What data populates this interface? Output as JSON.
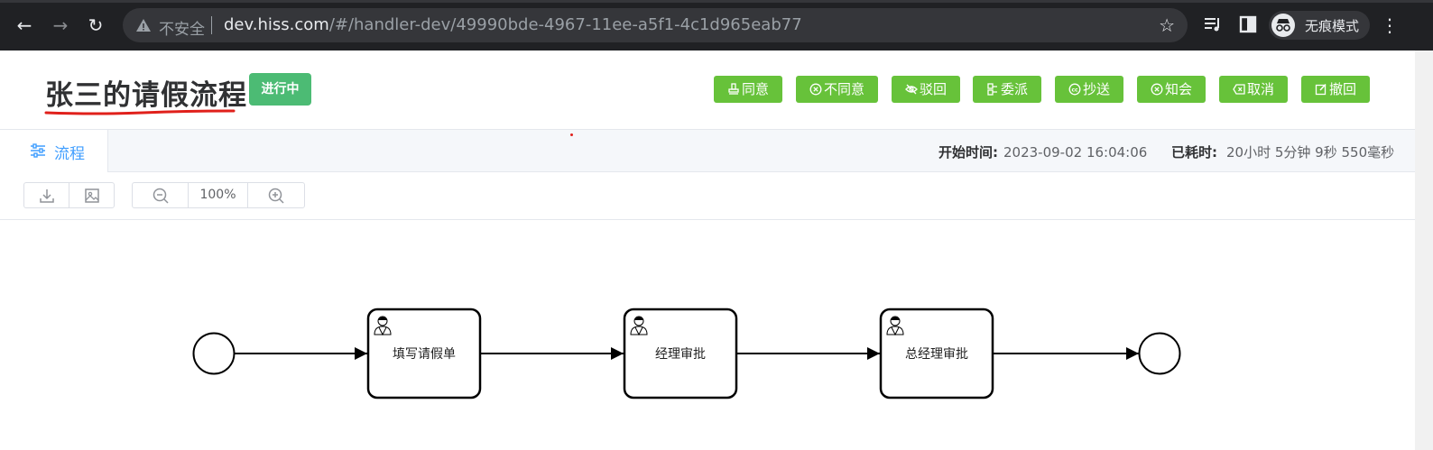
{
  "browser": {
    "security_label": "不安全",
    "url_host": "dev.hiss.com",
    "url_path": "/#/handler-dev/49990bde-4967-11ee-a5f1-4c1d965eab77",
    "profile_label": "无痕模式",
    "icons": [
      "back-icon",
      "forward-icon",
      "reload-icon",
      "warning-icon",
      "star-icon",
      "media-icon",
      "sidepanel-icon",
      "incognito-icon",
      "menu-icon"
    ]
  },
  "header": {
    "title": "张三的请假流程",
    "status": "进行中",
    "colors": {
      "status": "#4cbb74",
      "action": "#67c23a",
      "underline": "#e0201b"
    }
  },
  "actions": [
    {
      "label": "同意",
      "icon": "stamp-icon"
    },
    {
      "label": "不同意",
      "icon": "circle-x-icon"
    },
    {
      "label": "驳回",
      "icon": "eye-off-icon"
    },
    {
      "label": "委派",
      "icon": "delegate-icon"
    },
    {
      "label": "抄送",
      "icon": "cc-icon"
    },
    {
      "label": "知会",
      "icon": "circle-x-icon"
    },
    {
      "label": "取消",
      "icon": "backspace-icon"
    },
    {
      "label": "撤回",
      "icon": "edit-icon"
    }
  ],
  "tabs": {
    "active": {
      "label": "流程",
      "icon": "sliders-icon"
    },
    "start_time_label": "开始时间:",
    "start_time": "2023-09-02 16:04:06",
    "elapsed_label": "已耗时:",
    "elapsed": "20小时 5分钟 9秒 550毫秒"
  },
  "toolbar": {
    "zoom": "100%",
    "tools": [
      "download-icon",
      "image-icon",
      "zoom-out-icon",
      "zoom-in-icon"
    ]
  },
  "diagram": {
    "nodes": [
      {
        "type": "start"
      },
      {
        "type": "user-task",
        "label": "填写请假单"
      },
      {
        "type": "user-task",
        "label": "经理审批"
      },
      {
        "type": "user-task",
        "label": "总经理审批"
      },
      {
        "type": "end"
      }
    ]
  }
}
